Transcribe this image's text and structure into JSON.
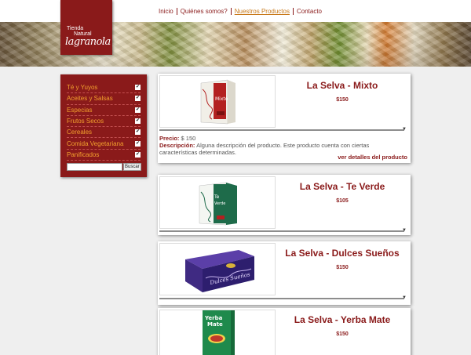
{
  "nav": {
    "items": [
      {
        "label": "Inicio"
      },
      {
        "label": "Quiénes somos?"
      },
      {
        "label": "Nuestros Productos"
      },
      {
        "label": "Contacto"
      }
    ],
    "active": "Nuestros Productos"
  },
  "logo": {
    "line1": "Tienda",
    "line2": "Natural",
    "brand": "lagranola"
  },
  "sidebar": {
    "categories": [
      {
        "label": "Té y Yuyos"
      },
      {
        "label": "Aceites y Salsas"
      },
      {
        "label": "Especias"
      },
      {
        "label": "Frutos Secos"
      },
      {
        "label": "Cereales"
      },
      {
        "label": "Comida Vegetariana"
      },
      {
        "label": "Panificados"
      }
    ],
    "search_button": "Buscar",
    "search_value": ""
  },
  "products": [
    {
      "name": "La Selva - Mixto",
      "price": "$150",
      "box_label": "Mixto",
      "expanded": true,
      "details": {
        "price_label": "Precio:",
        "price_value": "$ 150",
        "desc_label": "Descripción:",
        "desc_value": "Alguna descripción del producto. Este producto cuenta con ciertas características determinadas.",
        "more_link": "ver detalles del producto"
      }
    },
    {
      "name": "La Selva - Te Verde",
      "price": "$105",
      "box_label": "Te Verde",
      "expanded": false
    },
    {
      "name": "La Selva - Dulces Sueños",
      "price": "$150",
      "box_label": "Dulces Sueños",
      "expanded": false
    },
    {
      "name": "La Selva - Yerba Mate",
      "price": "$150",
      "box_label": "Yerba Mate",
      "expanded": false
    }
  ],
  "colors": {
    "brand": "#8a1a1a",
    "accent": "#f2a02e",
    "active_nav": "#c8791a"
  },
  "icons": {
    "checkbox": "check-icon",
    "expand": "triangle-down-icon"
  }
}
